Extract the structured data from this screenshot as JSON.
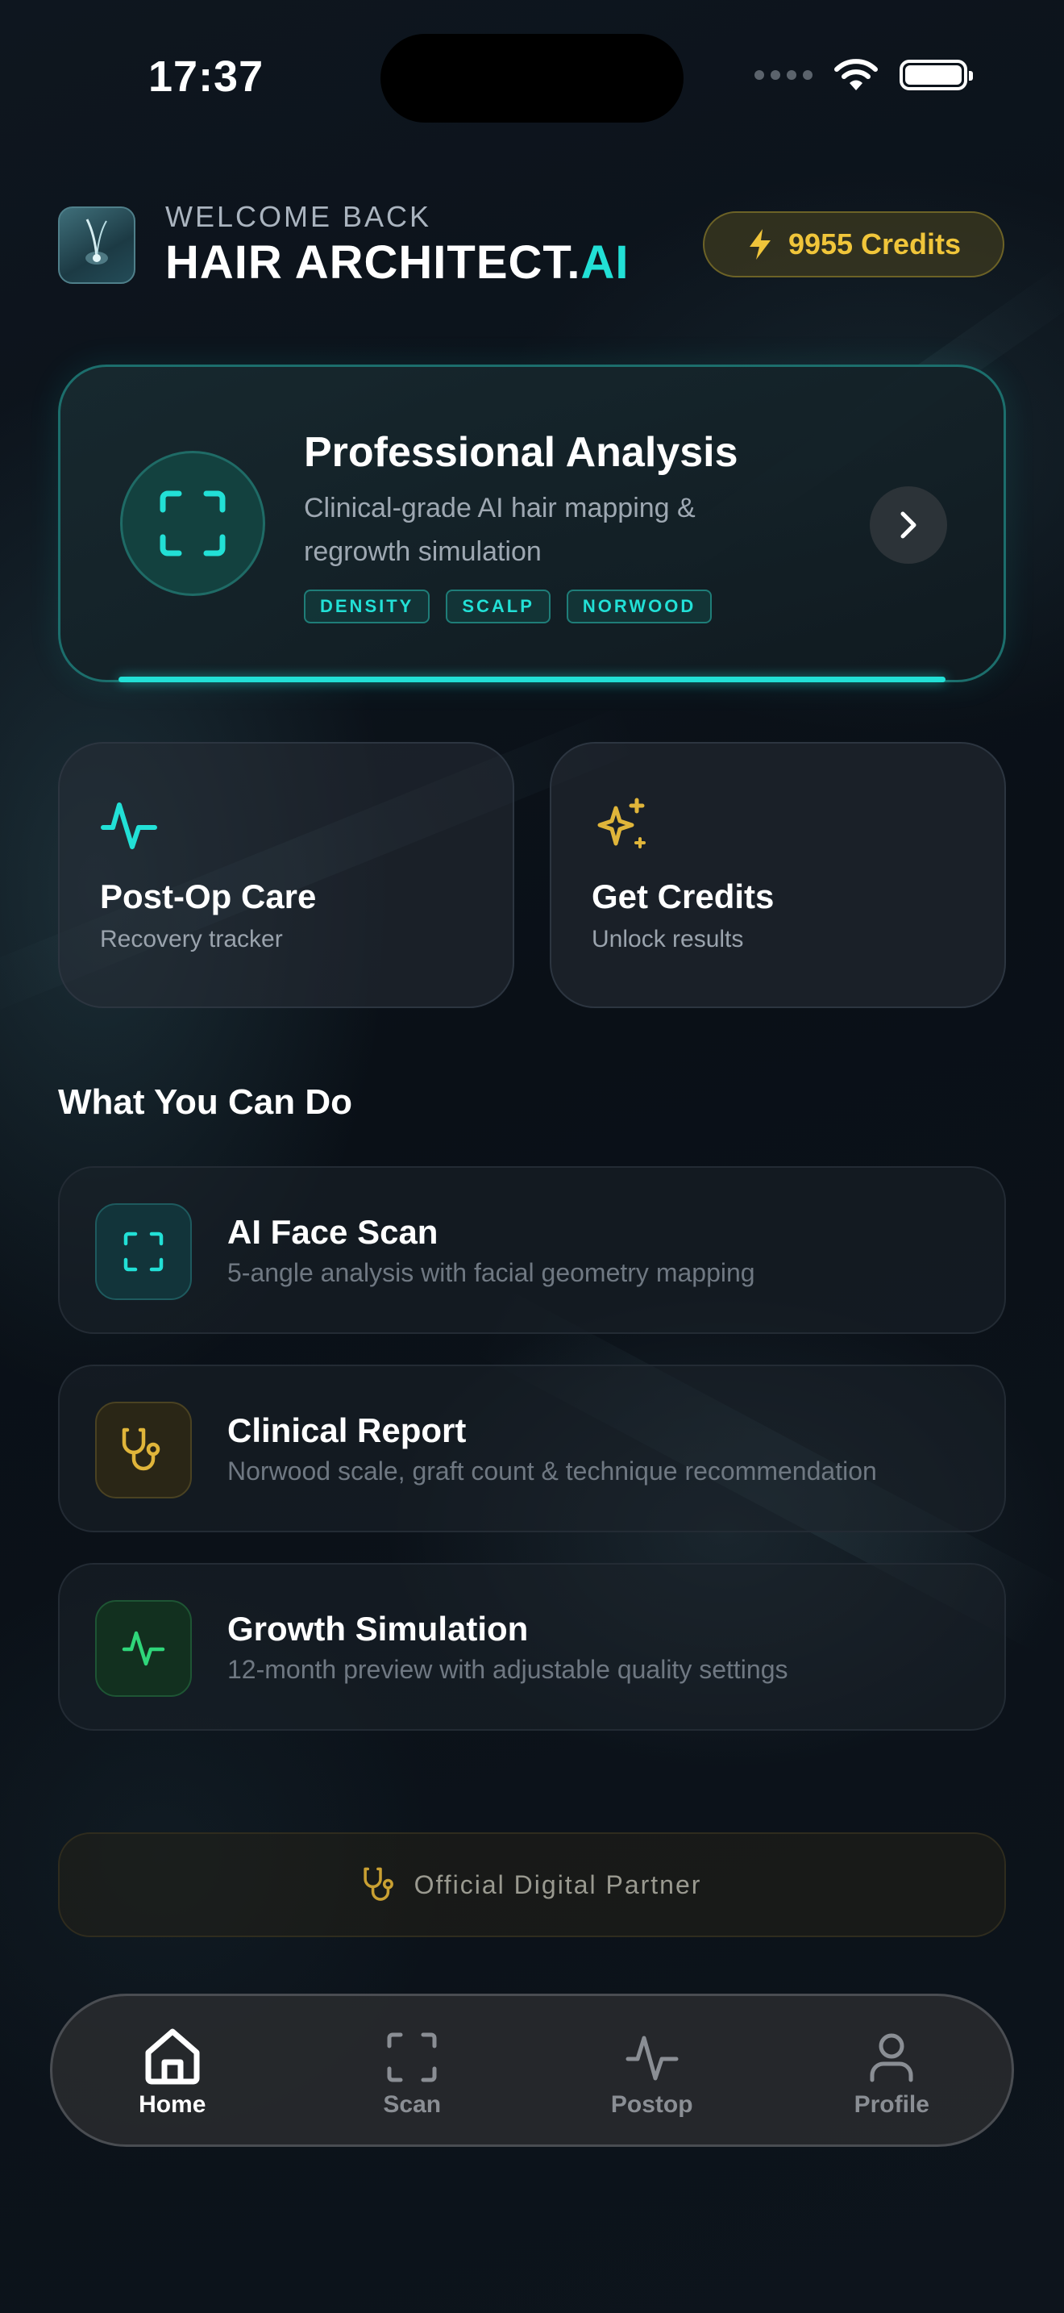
{
  "status_bar": {
    "time": "17:37"
  },
  "header": {
    "welcome": "WELCOME BACK",
    "brand_main": "HAIR ARCHITECT.",
    "brand_accent": "AI",
    "credits": "9955 Credits"
  },
  "hero": {
    "title": "Professional Analysis",
    "subtitle": "Clinical-grade AI hair mapping & regrowth simulation",
    "chips": [
      "DENSITY",
      "SCALP",
      "NORWOOD"
    ]
  },
  "quick_cards": [
    {
      "title": "Post-Op Care",
      "subtitle": "Recovery tracker",
      "icon": "activity-icon"
    },
    {
      "title": "Get Credits",
      "subtitle": "Unlock results",
      "icon": "sparkles-icon"
    }
  ],
  "section_title": "What You Can Do",
  "features": [
    {
      "title": "AI Face Scan",
      "subtitle": "5-angle analysis with facial geometry mapping",
      "icon": "scan-icon",
      "accent": "#22e0d6"
    },
    {
      "title": "Clinical Report",
      "subtitle": "Norwood scale, graft count & technique recommendation",
      "icon": "stethoscope-icon",
      "accent": "#e0b53a"
    },
    {
      "title": "Growth Simulation",
      "subtitle": "12-month preview with adjustable quality settings",
      "icon": "activity-icon",
      "accent": "#2fd67a"
    }
  ],
  "partner": {
    "label": "Official Digital Partner",
    "icon": "stethoscope-icon"
  },
  "tabs": [
    {
      "label": "Home",
      "icon": "home-icon",
      "active": true
    },
    {
      "label": "Scan",
      "icon": "scan-icon",
      "active": false
    },
    {
      "label": "Postop",
      "icon": "activity-icon",
      "active": false
    },
    {
      "label": "Profile",
      "icon": "user-icon",
      "active": false
    }
  ],
  "colors": {
    "accent": "#22e0d6",
    "gold": "#f0c53a",
    "green": "#2fd67a",
    "background": "#0b1118"
  }
}
